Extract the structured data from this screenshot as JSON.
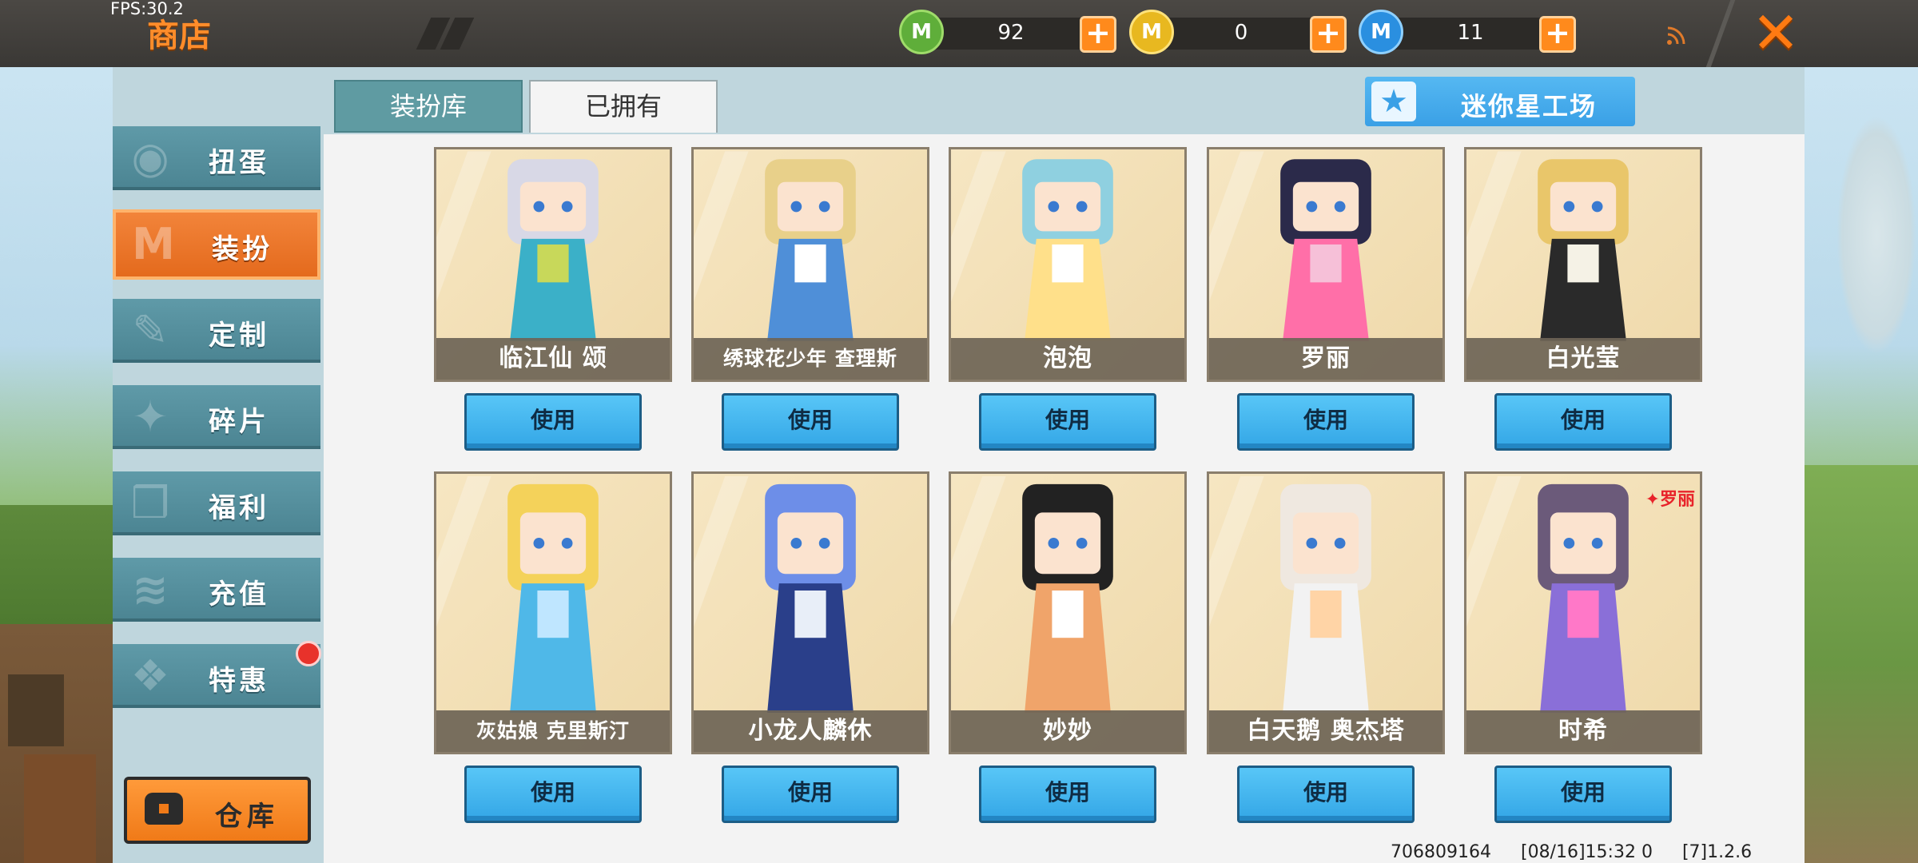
{
  "fps": "FPS:30.2",
  "header": {
    "title": "商店"
  },
  "currencies": [
    {
      "icon": "green-gem-icon",
      "symbol": "M",
      "value": "92",
      "color": "#5fae3a"
    },
    {
      "icon": "gold-coin-icon",
      "symbol": "M",
      "value": "0",
      "color": "#e8b820"
    },
    {
      "icon": "blue-coin-icon",
      "symbol": "M",
      "value": "11",
      "color": "#2a8fe0"
    }
  ],
  "sidebar": {
    "items": [
      {
        "label": "扭蛋",
        "icon": "capsule-icon"
      },
      {
        "label": "装扮",
        "icon": "shirt-icon",
        "active": true
      },
      {
        "label": "定制",
        "icon": "pencil-icon"
      },
      {
        "label": "碎片",
        "icon": "puzzle-icon"
      },
      {
        "label": "福利",
        "icon": "gift-icon"
      },
      {
        "label": "充值",
        "icon": "coins-icon"
      },
      {
        "label": "特惠",
        "icon": "discount-icon",
        "has_notification": true
      }
    ],
    "storage_label": "仓库"
  },
  "tabs": [
    {
      "label": "装扮库",
      "active": true
    },
    {
      "label": "已拥有",
      "active": false
    }
  ],
  "workshop_label": "迷你星工场",
  "use_label": "使用",
  "outfits": [
    {
      "name": "临江仙 颂",
      "palette": [
        "#d8d8e6",
        "#3bb0c8",
        "#c8d85a"
      ]
    },
    {
      "name": "绣球花少年 查理斯",
      "palette": [
        "#e8d08a",
        "#4f8fd8",
        "#ffffff"
      ]
    },
    {
      "name": "泡泡",
      "palette": [
        "#8fd0e0",
        "#ffe08a",
        "#ffffff"
      ]
    },
    {
      "name": "罗丽",
      "palette": [
        "#2b2a4a",
        "#ff6fa8",
        "#f6c0d8"
      ]
    },
    {
      "name": "白光莹",
      "palette": [
        "#e9c66a",
        "#2a2a2a",
        "#f5f2e6"
      ]
    },
    {
      "name": "灰姑娘 克里斯汀",
      "palette": [
        "#f4d25a",
        "#4fb8e8",
        "#bfe6ff"
      ]
    },
    {
      "name": "小龙人麟休",
      "palette": [
        "#6d8ee8",
        "#2a3f8a",
        "#e8eef8"
      ]
    },
    {
      "name": "妙妙",
      "palette": [
        "#222222",
        "#f0a46a",
        "#ffffff"
      ]
    },
    {
      "name": "白天鹅 奥杰塔",
      "palette": [
        "#efe8e0",
        "#f2f2f2",
        "#ffd4a6"
      ]
    },
    {
      "name": "时希",
      "palette": [
        "#6b5a7a",
        "#8a6fd8",
        "#ff78c8"
      ],
      "tag": "✦罗丽"
    }
  ],
  "footer": {
    "uid": "706809164",
    "timestamp": "[08/16]15:32 0",
    "version": "[7]1.2.6"
  }
}
